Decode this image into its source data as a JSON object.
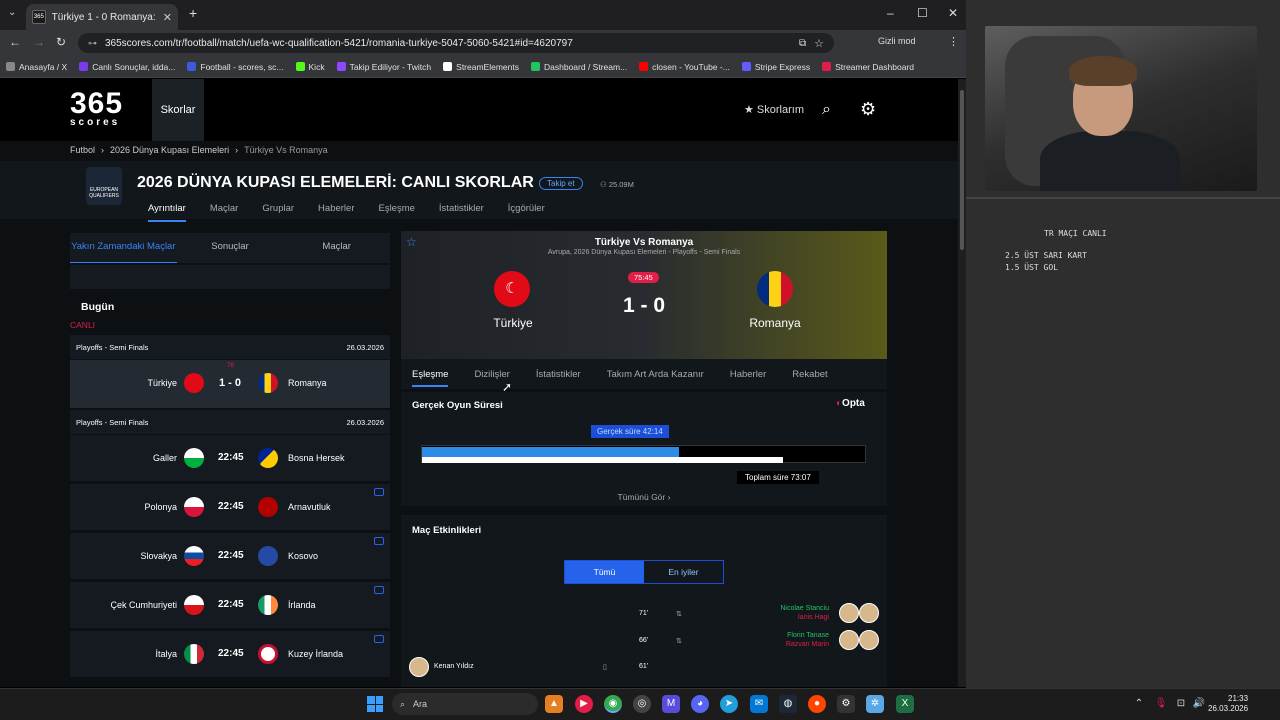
{
  "browser": {
    "tab_title": "Türkiye 1 - 0 Romanya: Maç ra",
    "url": "365scores.com/tr/football/match/uefa-wc-qualification-5421/romania-turkiye-5047-5060-5421#id=4620797",
    "incognito": "Gizli mod",
    "bookmarks": [
      "Anasayfa / X",
      "Canlı Sonuçlar, idda...",
      "Football - scores, sc...",
      "Kick",
      "Takip Ediliyor - Twitch",
      "StreamElements",
      "Dashboard / Stream...",
      "closen - YouTube -...",
      "Stripe Express",
      "Streamer Dashboard"
    ]
  },
  "site": {
    "logo_top": "365",
    "logo_bottom": "scores",
    "nav_active": "Skorlar",
    "my_scores": "Skorlarım",
    "breadcrumb": [
      "Futbol",
      "2026 Dünya Kupası Elemeleri",
      "Türkiye Vs Romanya"
    ],
    "badge_text": "EUROPEAN QUALIFIERS",
    "comp_title": "2026 DÜNYA KUPASI ELEMELERİ: CANLI SKORLAR",
    "follow": "Takip et",
    "followers": "25.09M",
    "comp_tabs": [
      "Ayrıntılar",
      "Maçlar",
      "Gruplar",
      "Haberler",
      "Eşleşme",
      "İstatistikler",
      "İçgörüler"
    ]
  },
  "left": {
    "tabs": [
      "Yakın Zamandaki Maçlar",
      "Sonuçlar",
      "Maçlar"
    ],
    "today": "Bugün",
    "live": "CANLI",
    "group1": {
      "name": "Playoffs - Semi Finals",
      "date": "26.03.2026"
    },
    "live_minute": "76'",
    "live_match": {
      "home": "Türkiye",
      "score": "1 - 0",
      "away": "Romanya"
    },
    "group2": {
      "name": "Playoffs - Semi Finals",
      "date": "26.03.2026"
    },
    "matches": [
      {
        "home": "Galler",
        "time": "22:45",
        "away": "Bosna Hersek"
      },
      {
        "home": "Polonya",
        "time": "22:45",
        "away": "Arnavutluk"
      },
      {
        "home": "Slovakya",
        "time": "22:45",
        "away": "Kosovo"
      },
      {
        "home": "Çek Cumhuriyeti",
        "time": "22:45",
        "away": "İrlanda"
      },
      {
        "home": "İtalya",
        "time": "22:45",
        "away": "Kuzey İrlanda"
      }
    ]
  },
  "match": {
    "title": "Türkiye Vs Romanya",
    "subtitle": "Avrupa, 2026 Dünya Kupası Elemeleri - Playoffs - Semi Finals",
    "home": "Türkiye",
    "away": "Romanya",
    "minute": "75:45",
    "score": "1 - 0",
    "tabs": [
      "Eşleşme",
      "Dizilişler",
      "İstatistikler",
      "Takım Art Arda Kazanır",
      "Haberler",
      "Rekabet"
    ]
  },
  "realtime": {
    "title": "Gerçek Oyun Süresi",
    "opta": "Opta",
    "label": "Gerçek süre 42:14",
    "total": "Toplam süre 73:07",
    "see_all": "Tümünü Gör",
    "real_fraction": 0.577,
    "total_fraction": 0.812
  },
  "events": {
    "title": "Maç Etkinlikleri",
    "toggle": [
      "Tümü",
      "En iyiler"
    ],
    "rows": [
      {
        "minute": "71'",
        "p1": "Nicolae Stanciu",
        "p2": "Ianis Hagi"
      },
      {
        "minute": "66'",
        "p1": "Florin Tanase",
        "p2": "Razvan Marin"
      },
      {
        "minute": "61'",
        "p1": "Kenan Yıldız"
      }
    ]
  },
  "overlay": {
    "title": "TR MAÇI CANLI",
    "line1": "2.5 ÜST SARI KART",
    "line2": "1.5 ÜST GOL"
  },
  "taskbar": {
    "search": "Ara",
    "time": "21:33",
    "date": "26.03.2026"
  }
}
